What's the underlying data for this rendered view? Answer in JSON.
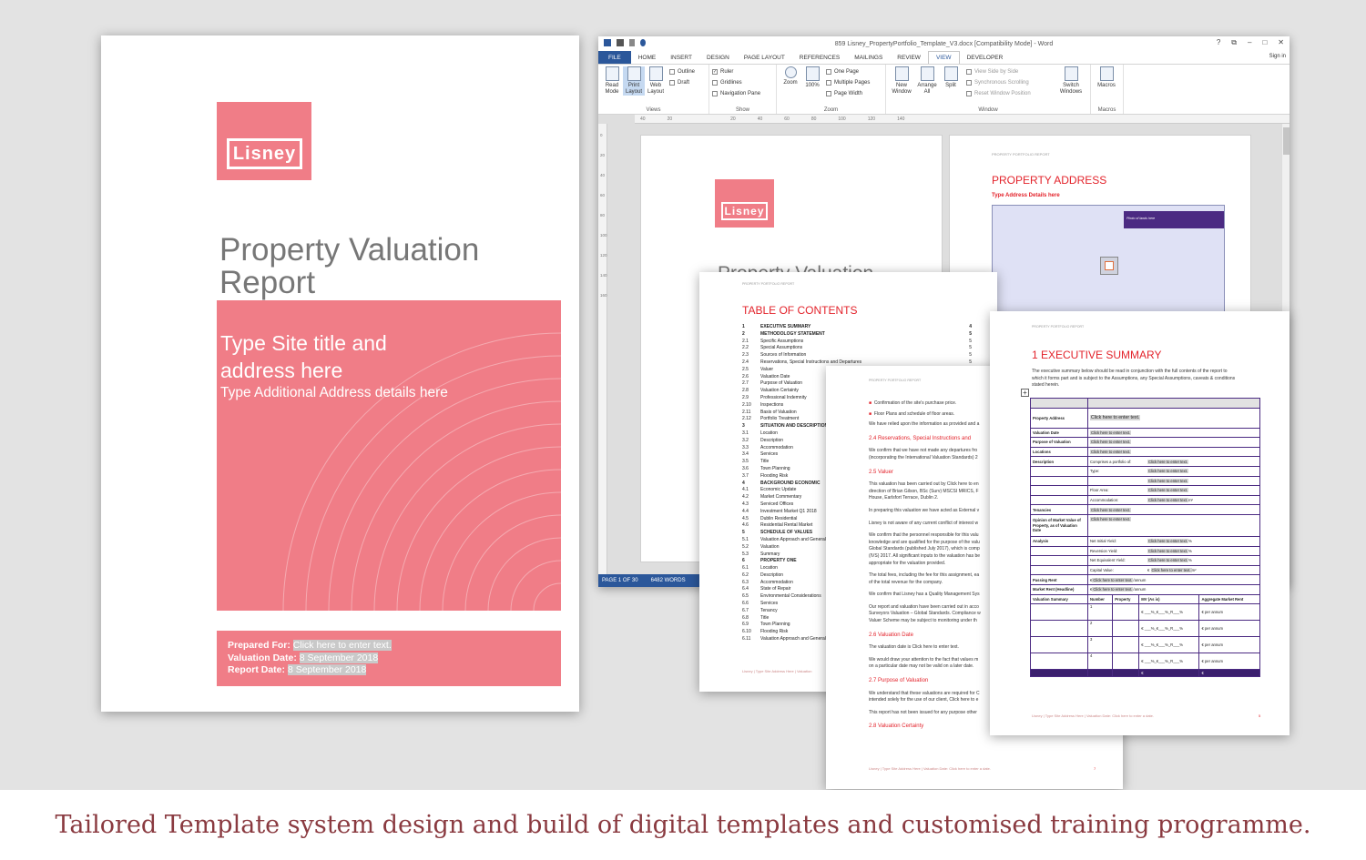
{
  "cover": {
    "logo": "Lisney",
    "title_line1": "Property Valuation",
    "title_line2": "Report",
    "site_title_line1": "Type Site title and",
    "site_title_line2": "address here",
    "additional_address": "Type Additional Address details here",
    "prepared_for_label": "Prepared For:",
    "prepared_for_value": "Click here to enter text.",
    "valuation_date_label": "Valuation Date:",
    "valuation_date_value": "8 September 2018",
    "report_date_label": "Report Date:",
    "report_date_value": "8 September 2018"
  },
  "word": {
    "window_title": "859 Lisney_PropertyPortfolio_Template_V3.docx [Compatibility Mode] - Word",
    "window_controls": [
      "?",
      "⧉",
      "–",
      "□",
      "✕"
    ],
    "sign_in": "Sign in",
    "tabs": [
      "FILE",
      "HOME",
      "INSERT",
      "DESIGN",
      "PAGE LAYOUT",
      "REFERENCES",
      "MAILINGS",
      "REVIEW",
      "VIEW",
      "DEVELOPER"
    ],
    "active_tab": "VIEW",
    "ribbon": {
      "views": {
        "label": "Views",
        "read_mode": "Read Mode",
        "print_layout": "Print Layout",
        "web_layout": "Web Layout",
        "outline": "Outline",
        "draft": "Draft"
      },
      "show": {
        "label": "Show",
        "ruler": "Ruler",
        "gridlines": "Gridlines",
        "navigation_pane": "Navigation Pane"
      },
      "zoom": {
        "label": "Zoom",
        "zoom": "Zoom",
        "hundred": "100%",
        "one_page": "One Page",
        "multiple_pages": "Multiple Pages",
        "page_width": "Page Width"
      },
      "window": {
        "label": "Window",
        "new_window": "New Window",
        "arrange_all": "Arrange All",
        "split": "Split",
        "view_side": "View Side by Side",
        "sync_scroll": "Synchronous Scrolling",
        "reset_pos": "Reset Window Position",
        "switch_windows": "Switch Windows"
      },
      "macros": {
        "label": "Macros",
        "macros": "Macros"
      }
    },
    "ruler_marks": [
      "40",
      "20",
      "20",
      "40",
      "60",
      "80",
      "100",
      "120",
      "140"
    ],
    "vruler_marks": [
      "0",
      "10",
      "20",
      "30",
      "40",
      "50",
      "60",
      "70",
      "80",
      "90",
      "100",
      "110",
      "120",
      "130",
      "140",
      "150",
      "160"
    ],
    "status_page": "PAGE 1 OF 30",
    "status_words": "6482 WORDS",
    "page1_logo": "Lisney",
    "page1_title_partial": "Property Valuation",
    "page2_header": "PROPERTY PORTFOLIO REPORT",
    "page2_title": "PROPERTY ADDRESS",
    "page2_subtitle": "Type Address Details here",
    "photo_label": "Photo of lands here"
  },
  "toc": {
    "header": "PROPERTY PORTFOLIO REPORT",
    "title": "TABLE OF CONTENTS",
    "rows": [
      {
        "n": "1",
        "t": "EXECUTIVE SUMMARY",
        "p": "4",
        "b": true
      },
      {
        "n": "2",
        "t": "METHODOLOGY STATEMENT",
        "p": "5",
        "b": true
      },
      {
        "n": "2.1",
        "t": "Specific Assumptions",
        "p": "5"
      },
      {
        "n": "2.2",
        "t": "Special Assumptions",
        "p": "5"
      },
      {
        "n": "2.3",
        "t": "Sources of Information",
        "p": "5"
      },
      {
        "n": "2.4",
        "t": "Reservations, Special Instructions and Departures",
        "p": "5"
      },
      {
        "n": "2.5",
        "t": "Valuer",
        "p": ""
      },
      {
        "n": "2.6",
        "t": "Valuation Date",
        "p": ""
      },
      {
        "n": "2.7",
        "t": "Purpose of Valuation",
        "p": ""
      },
      {
        "n": "2.8",
        "t": "Valuation Certainty",
        "p": ""
      },
      {
        "n": "2.9",
        "t": "Professional Indemnity",
        "p": ""
      },
      {
        "n": "2.10",
        "t": "Inspections",
        "p": ""
      },
      {
        "n": "2.11",
        "t": "Basis of Valuation",
        "p": ""
      },
      {
        "n": "2.12",
        "t": "Portfolio Treatment",
        "p": ""
      },
      {
        "n": "",
        "t": "",
        "p": ""
      },
      {
        "n": "3",
        "t": "SITUATION AND DESCRIPTION",
        "p": "",
        "b": true
      },
      {
        "n": "3.1",
        "t": "Location",
        "p": ""
      },
      {
        "n": "3.2",
        "t": "Description",
        "p": ""
      },
      {
        "n": "3.3",
        "t": "Accommodation",
        "p": ""
      },
      {
        "n": "3.4",
        "t": "Services",
        "p": ""
      },
      {
        "n": "3.5",
        "t": "Title",
        "p": ""
      },
      {
        "n": "3.6",
        "t": "Town Planning",
        "p": ""
      },
      {
        "n": "3.7",
        "t": "Flooding Risk",
        "p": ""
      },
      {
        "n": "",
        "t": "",
        "p": ""
      },
      {
        "n": "4",
        "t": "BACKGROUND ECONOMIC",
        "p": "",
        "b": true
      },
      {
        "n": "4.1",
        "t": "Economic Update",
        "p": ""
      },
      {
        "n": "4.2",
        "t": "Market Commentary",
        "p": ""
      },
      {
        "n": "4.3",
        "t": "Serviced Offices",
        "p": ""
      },
      {
        "n": "4.4",
        "t": "Investment Market Q1 2018",
        "p": ""
      },
      {
        "n": "4.5",
        "t": "Dublin Residential",
        "p": ""
      },
      {
        "n": "4.6",
        "t": "Residential Rental Market",
        "p": ""
      },
      {
        "n": "5",
        "t": "SCHEDULE OF VALUES",
        "p": "",
        "b": true
      },
      {
        "n": "5.1",
        "t": "Valuation Approach and General",
        "p": ""
      },
      {
        "n": "5.2",
        "t": "Valuation",
        "p": ""
      },
      {
        "n": "5.3",
        "t": "Summary",
        "p": ""
      },
      {
        "n": "",
        "t": "",
        "p": ""
      },
      {
        "n": "6",
        "t": "PROPERTY ONE",
        "p": "",
        "b": true
      },
      {
        "n": "6.1",
        "t": "Location",
        "p": ""
      },
      {
        "n": "6.2",
        "t": "Description",
        "p": ""
      },
      {
        "n": "6.3",
        "t": "Accommodation",
        "p": ""
      },
      {
        "n": "6.4",
        "t": "State of Repair",
        "p": ""
      },
      {
        "n": "6.5",
        "t": "Environmental Considerations",
        "p": ""
      },
      {
        "n": "6.6",
        "t": "Services",
        "p": ""
      },
      {
        "n": "6.7",
        "t": "Tenancy",
        "p": ""
      },
      {
        "n": "6.8",
        "t": "Title",
        "p": ""
      },
      {
        "n": "6.9",
        "t": "Town Planning",
        "p": ""
      },
      {
        "n": "6.10",
        "t": "Flooding Risk",
        "p": ""
      },
      {
        "n": "6.11",
        "t": "Valuation Approach and General",
        "p": ""
      }
    ],
    "footer": "Lisney | Type Site Address Here | Valuation"
  },
  "method": {
    "header": "PROPERTY PORTFOLIO REPORT",
    "bullet1": "Confirmation of the site's purchase price.",
    "bullet2": "Floor Plans and schedule of floor areas.",
    "p1": "We have relied upon the information as provided and a",
    "h24": "2.4      Reservations, Special Instructions and",
    "p2a": "We confirm that we have not made any departures fro",
    "p2b": "(incorporating the International Valuation Standards) 2",
    "h25": "2.5      Valuer",
    "p3a": "This valuation has been carried out by Click here to en",
    "p3b": "direction of Brian Gilson, BSc (Surv) MSCSI MRICS, F",
    "p3c": "House, Earlsfort Terrace, Dublin 2.",
    "p4": "In preparing this valuation we have acted as External v",
    "p5": "Lisney is not aware of any current conflict of interest w",
    "p6a": "We confirm that the personnel responsible for this valu",
    "p6b": "knowledge and are qualified for the purpose of the valu",
    "p6c": "Global Standards (published July 2017), which is comp",
    "p6d": "(IVS) 2017. All significant inputs to the valuation has be",
    "p6e": "appropriate for the valuation provided.",
    "p7a": "The total fees, including the fee for this assignment, ea",
    "p7b": "of the total revenue for the company.",
    "p8": "We confirm that Lisney has a Quality Management Sys",
    "p9a": "Our report and valuation have been carried out in acco",
    "p9b": "Surveyors Valuation – Global Standards. Compliance w",
    "p9c": "Valuer Scheme may be subject to monitoring under th",
    "h26": "2.6      Valuation Date",
    "p10": "The valuation date is Click here to enter text.",
    "p11a": "We would draw your attention to the fact that values m",
    "p11b": "on a particular date may not be valid on a later date.",
    "h27": "2.7      Purpose of Valuation",
    "p12a": "We understand that these valuations are required for C",
    "p12b": "intended solely for the use of our client, Click here to e",
    "p13": "This report has not been issued for any purpose other",
    "h28": "2.8      Valuation Certainty",
    "footer": "Lisney | Type Site Address Here | Valuation Date: Click here to enter a date.",
    "page_no": "7"
  },
  "exec": {
    "header": "PROPERTY PORTFOLIO REPORT",
    "title": "1   EXECUTIVE SUMMARY",
    "intro1": "The executive summary below should be read in conjunction with the full contents of the report to",
    "intro2": "which it forms part and is subject to the Assumptions, any Special Assumptions, caveats & conditions",
    "intro3": "stated herein.",
    "click": "Click here to enter text.",
    "labels": {
      "property_address": "Property Address",
      "valuation_date": "Valuation Date",
      "purpose": "Purpose of Valuation",
      "locations": "Locations",
      "description": "Description",
      "tenancies": "Tenancies",
      "opinion": "Opinion of Market Value of Property, as of Valuation Date",
      "analysis": "Analysis",
      "passing_rent": "Passing Rent",
      "market_rent": "Market Rent (Headline)",
      "valuation_summary": "Valuation Summary"
    },
    "desc_rows": [
      "Comprises a portfolio of:",
      "Type:",
      "",
      "Floor Area:",
      "Accommodation:"
    ],
    "analysis_rows": [
      "Net Initial Yield:",
      "Reversion Yield:",
      "Net Equivalent Yield:",
      "Capital Value:"
    ],
    "percent": "%",
    "sqm": "m²",
    "euro": "€",
    "per_annum": "/annum",
    "summary_headers": [
      "Number",
      "Property",
      "MV (As is)",
      "Aggregate Market Rent"
    ],
    "summary_rows": [
      "1",
      "2",
      "3",
      "4"
    ],
    "mv_placeholder": "€ ___%_€___%_R___%",
    "rent_placeholder": "€   per annum",
    "footer": "Lisney | Type Site Address Here | Valuation Date: Click here to enter a date.",
    "page_no": "5"
  },
  "caption": "Tailored Template system design and build of digital templates and customised training programme."
}
